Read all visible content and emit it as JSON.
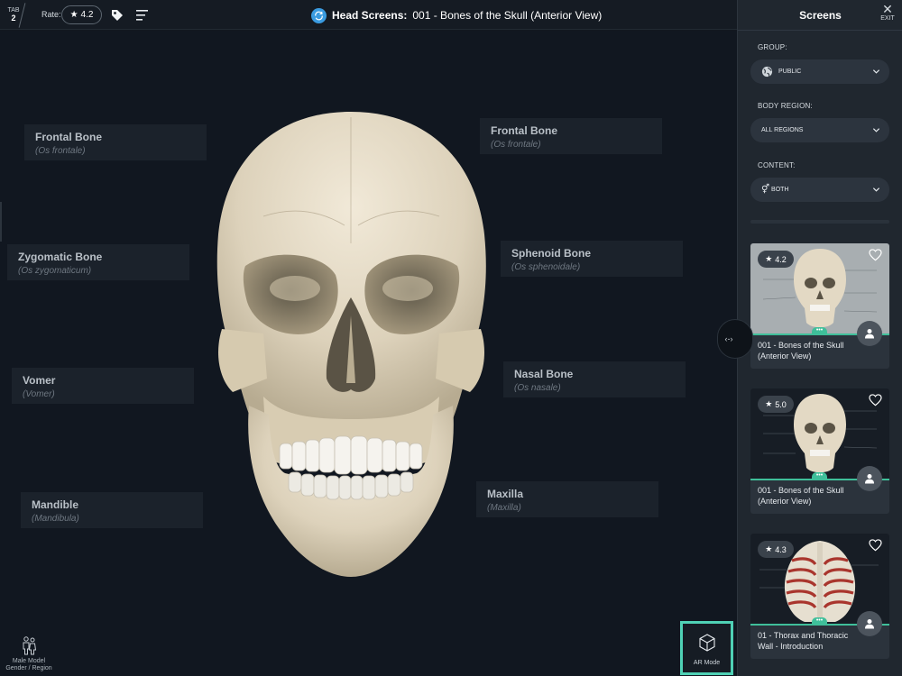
{
  "topbar": {
    "tab_label": "TAB",
    "tab_number": "2",
    "rate_label": "Rate:",
    "rate_value": "4.2",
    "title_bold": "Head Screens:",
    "title_rest": "001 - Bones of the Skull (Anterior View)"
  },
  "labels": {
    "frontal_left": {
      "name": "Frontal Bone",
      "latin": "(Os frontale)"
    },
    "frontal_right": {
      "name": "Frontal Bone",
      "latin": "(Os frontale)"
    },
    "zygomatic": {
      "name": "Zygomatic Bone",
      "latin": "(Os zygomaticum)"
    },
    "sphenoid": {
      "name": "Sphenoid Bone",
      "latin": "(Os sphenoidale)"
    },
    "vomer": {
      "name": "Vomer",
      "latin": "(Vomer)"
    },
    "nasal": {
      "name": "Nasal Bone",
      "latin": "(Os nasale)"
    },
    "mandible": {
      "name": "Mandible",
      "latin": "(Mandibula)"
    },
    "maxilla": {
      "name": "Maxilla",
      "latin": "(Maxilla)"
    }
  },
  "model_control": {
    "line1": "Male Model",
    "line2": "Gender / Region"
  },
  "ar_button": {
    "label": "AR Mode"
  },
  "collapse_button": {
    "label": "‹-›"
  },
  "panel": {
    "title": "Screens",
    "exit_label": "EXIT",
    "group": {
      "label": "GROUP:",
      "value": "PUBLIC"
    },
    "body_region": {
      "label": "BODY REGION:",
      "value": "ALL REGIONS"
    },
    "content": {
      "label": "CONTENT:",
      "value": "BOTH"
    },
    "cards": [
      {
        "rating": "4.2",
        "caption": "001 - Bones of the Skull (Anterior View)"
      },
      {
        "rating": "5.0",
        "caption": "001 - Bones of the Skull (Anterior View)"
      },
      {
        "rating": "4.3",
        "caption": "01 - Thorax and Thoracic Wall - Introduction"
      }
    ]
  },
  "colors": {
    "accent": "#4fd1b5",
    "card_accent": "#3fbf9a",
    "title_icon": "#3a9be0"
  },
  "icons": [
    "star-icon",
    "tag-icon",
    "menu-icon",
    "sync-icon",
    "globe-icon",
    "gender-icon",
    "chevron-down-icon",
    "heart-icon",
    "user-icon",
    "ar-cube-icon",
    "person-figure-icon",
    "close-icon"
  ]
}
